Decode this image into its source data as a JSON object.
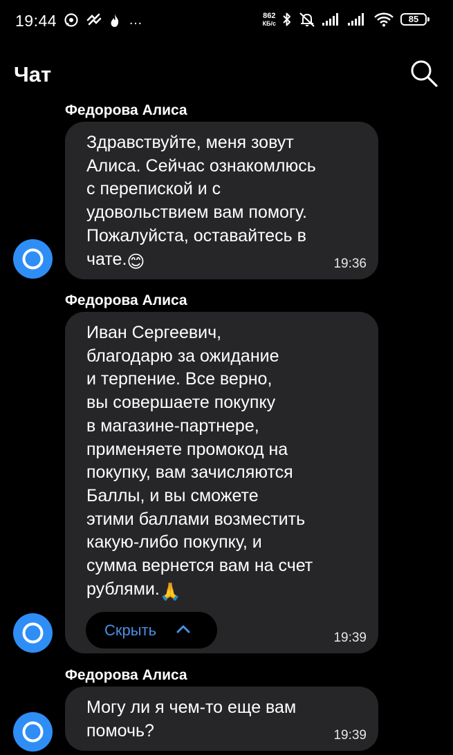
{
  "status_bar": {
    "time": "19:44",
    "network_speed_value": "862",
    "network_speed_unit": "КБ/с",
    "battery": "85",
    "overflow_indicator": "…",
    "icons": [
      "whatsapp-icon",
      "tiktok-icon",
      "flame-icon",
      "bluetooth-icon",
      "mute-icon",
      "signal-icon",
      "signal-icon",
      "wifi-icon",
      "battery-icon"
    ]
  },
  "header": {
    "title": "Чат",
    "search_icon": "search-icon"
  },
  "messages": [
    {
      "sender": "Федорова Алиса",
      "text": "Здравствуйте, меня зовут\nАлиса. Сейчас ознакомлюсь\nс перепиской и с\nудовольствием вам помогу.\nПожалуйста, оставайтесь в\nчате.",
      "emoji": "😊",
      "time": "19:36"
    },
    {
      "sender": "Федорова Алиса",
      "text": "Иван Сергеевич,\nблагодарю за ожидание\nи терпение. Все верно,\nвы совершаете покупку\nв магазине-партнере,\nприменяете промокод на\nпокупку, вам зачисляются\nБаллы, и вы сможете\nэтими баллами возместить\nкакую-либо покупку, и\nсумма вернется вам на счет\nрублями.",
      "emoji": "🙏",
      "collapse_label": "Скрыть",
      "time": "19:39"
    },
    {
      "sender": "Федорова Алиса",
      "text": "Могу ли я чем-то еще вам\nпомочь?",
      "time": "19:39"
    }
  ],
  "colors": {
    "background": "#000000",
    "bubble": "#262628",
    "avatar": "#2f8ef6",
    "link": "#4b8fe6"
  }
}
